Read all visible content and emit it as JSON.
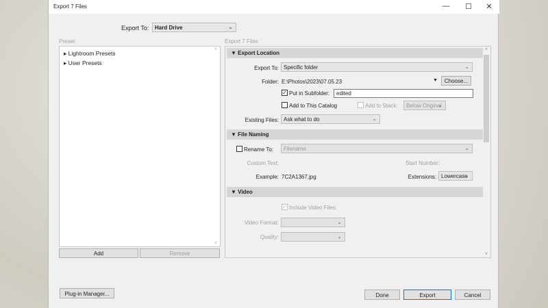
{
  "window": {
    "title": "Export 7 Files",
    "minimize": "—",
    "maximize": "☐",
    "close": "✕"
  },
  "top": {
    "export_to_label": "Export To:",
    "export_to_value": "Hard Drive"
  },
  "preset": {
    "label": "Preset:",
    "items": [
      "Lightroom Presets",
      "User Presets"
    ],
    "add": "Add",
    "remove": "Remove"
  },
  "right": {
    "label": "Export 7 Files",
    "export_location": {
      "header": "Export Location",
      "export_to_label": "Export To:",
      "export_to_value": "Specific folder",
      "folder_label": "Folder:",
      "folder_value": "E:\\Photos\\2023\\07.05.23",
      "choose": "Choose...",
      "subfolder_label": "Put in Subfolder:",
      "subfolder_checked": true,
      "subfolder_value": "edited",
      "add_catalog_label": "Add to This Catalog",
      "add_stack_label": "Add to Stack:",
      "stack_value": "Below Original",
      "existing_label": "Existing Files:",
      "existing_value": "Ask what to do"
    },
    "file_naming": {
      "header": "File Naming",
      "rename_label": "Rename To:",
      "rename_value": "Filename",
      "custom_text_label": "Custom Text:",
      "start_number_label": "Start Number:",
      "example_label": "Example:",
      "example_value": "7C2A1367.jpg",
      "extensions_label": "Extensions:",
      "extensions_value": "Lowercase"
    },
    "video": {
      "header": "Video",
      "include_label": "Include Video Files:",
      "format_label": "Video Format:",
      "quality_label": "Quality:"
    }
  },
  "bottom": {
    "plugin_manager": "Plug-in Manager...",
    "done": "Done",
    "export": "Export",
    "cancel": "Cancel"
  }
}
